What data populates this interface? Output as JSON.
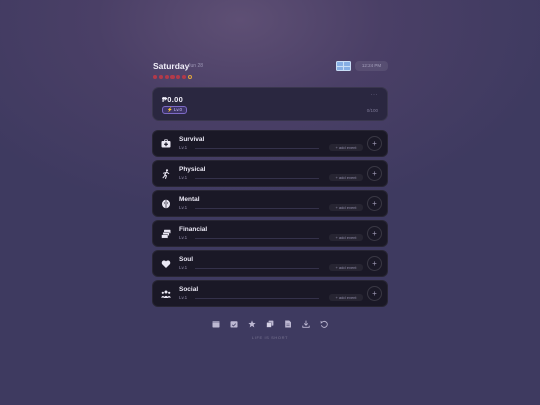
{
  "header": {
    "day": "Saturday",
    "date": "Jun 28",
    "time": "12:24 PM"
  },
  "hearts": {
    "filled": 6,
    "total": 7
  },
  "balance": {
    "amount": "₱0.00",
    "more": "···",
    "level": "⚡ Lv.0",
    "count": "0/100"
  },
  "categories": [
    {
      "name": "Survival",
      "level": "Lv.1",
      "add_label": "+ add event",
      "icon": "first-aid-icon"
    },
    {
      "name": "Physical",
      "level": "Lv.1",
      "add_label": "+ add event",
      "icon": "running-figure-icon"
    },
    {
      "name": "Mental",
      "level": "Lv.1",
      "add_label": "+ add event",
      "icon": "brain-icon"
    },
    {
      "name": "Financial",
      "level": "Lv.1",
      "add_label": "+ add event",
      "icon": "money-stack-icon"
    },
    {
      "name": "Soul",
      "level": "Lv.1",
      "add_label": "+ add event",
      "icon": "heart-icon"
    },
    {
      "name": "Social",
      "level": "Lv.1",
      "add_label": "+ add event",
      "icon": "people-icon"
    }
  ],
  "toolbar": [
    "calendar-icon",
    "calendar-check-icon",
    "star-icon",
    "copy-icon",
    "file-icon",
    "download-icon",
    "undo-icon"
  ],
  "footer": "LIFE IS SHORT",
  "colors": {
    "accent": "#7d6ac6",
    "heart": "#b23a4a",
    "heart_empty": "#e2a63b",
    "card": "#1a1826"
  }
}
